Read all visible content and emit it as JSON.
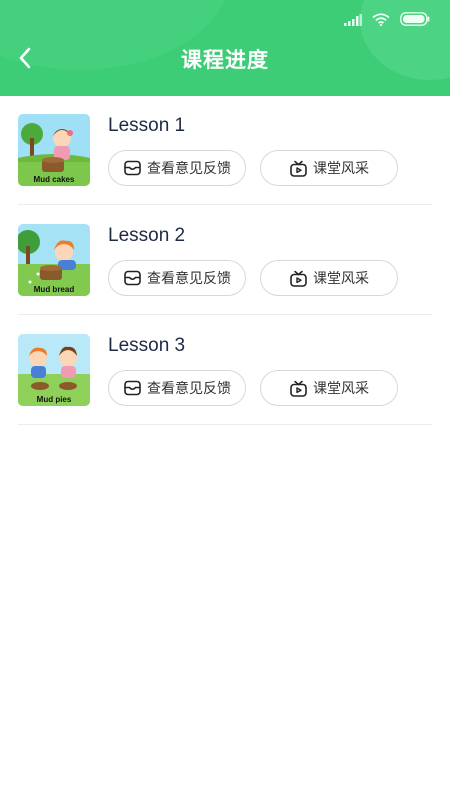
{
  "header": {
    "title": "课程进度",
    "back_icon": "chevron-left-icon",
    "color": "#3ccd76"
  },
  "status_bar": {
    "icons": [
      "signal-icon",
      "wifi-icon",
      "battery-icon"
    ]
  },
  "lessons": [
    {
      "title": "Lesson 1",
      "thumbnail_caption": "Mud cakes",
      "feedback_label": "查看意见反馈",
      "classroom_label": "课堂风采"
    },
    {
      "title": "Lesson 2",
      "thumbnail_caption": "Mud bread",
      "feedback_label": "查看意见反馈",
      "classroom_label": "课堂风采"
    },
    {
      "title": "Lesson 3",
      "thumbnail_caption": "Mud pies",
      "feedback_label": "查看意见反馈",
      "classroom_label": "课堂风采"
    }
  ]
}
